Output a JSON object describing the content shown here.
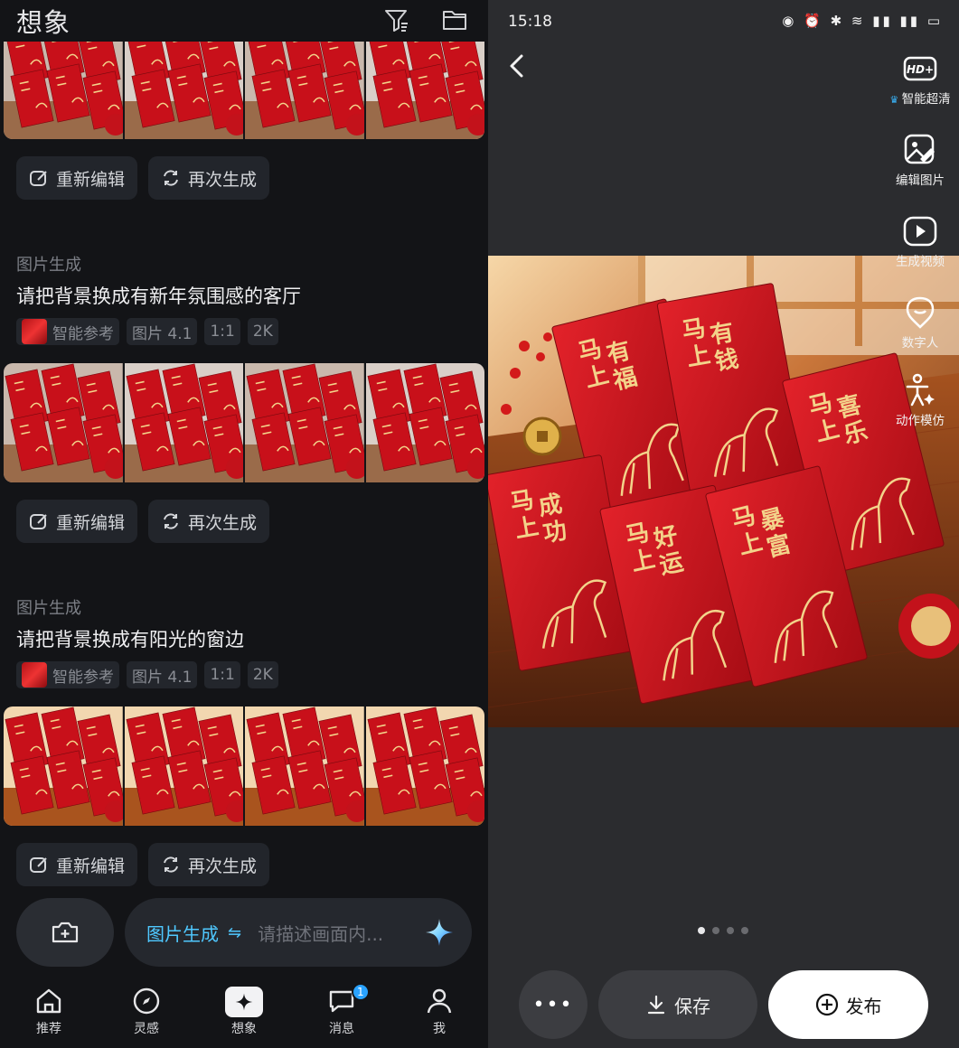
{
  "left": {
    "title": "想象",
    "sections": [
      {
        "actions": {
          "edit": "重新编辑",
          "regen": "再次生成"
        }
      },
      {
        "category": "图片生成",
        "prompt": "请把背景换成有新年氛围感的客厅",
        "tags": {
          "ref": "智能参考",
          "model": "图片 4.1",
          "ratio": "1:1",
          "res": "2K"
        },
        "actions": {
          "edit": "重新编辑",
          "regen": "再次生成"
        }
      },
      {
        "category": "图片生成",
        "prompt": "请把背景换成有阳光的窗边",
        "tags": {
          "ref": "智能参考",
          "model": "图片 4.1",
          "ratio": "1:1",
          "res": "2K"
        },
        "actions": {
          "edit": "重新编辑",
          "regen": "再次生成"
        }
      }
    ],
    "composer": {
      "mode": "图片生成",
      "swap_glyph": "⇋",
      "placeholder": "请描述画面内..."
    },
    "tabs": [
      {
        "label": "推荐",
        "icon": "home-icon"
      },
      {
        "label": "灵感",
        "icon": "compass-icon"
      },
      {
        "label": "想象",
        "icon": "sparkle-icon"
      },
      {
        "label": "消息",
        "icon": "chat-icon",
        "badge": "1"
      },
      {
        "label": "我",
        "icon": "person-icon"
      }
    ]
  },
  "right": {
    "status": {
      "time": "15:18",
      "icons": "◉ ⏰ ✱ ≋ ▮▮ ▮▮ ▭"
    },
    "tools": [
      {
        "label": "智能超清",
        "icon": "hd-plus-icon"
      },
      {
        "label": "编辑图片",
        "icon": "edit-image-icon"
      },
      {
        "label": "生成视频",
        "icon": "play-video-icon"
      },
      {
        "label": "数字人",
        "icon": "digital-human-icon"
      },
      {
        "label": "动作模仿",
        "icon": "motion-mimic-icon"
      }
    ],
    "envelopes": [
      "马上有福",
      "马上有钱",
      "马上喜乐",
      "马上成功",
      "马上好运",
      "马上暴富"
    ],
    "pagination": {
      "total": 4,
      "current": 1
    },
    "actions": {
      "more": "•••",
      "save": "保存",
      "publish": "发布"
    }
  },
  "colors": {
    "accent": "#4fc8ff",
    "envelope_red": "#c8101a",
    "gold": "#f3d38a"
  }
}
